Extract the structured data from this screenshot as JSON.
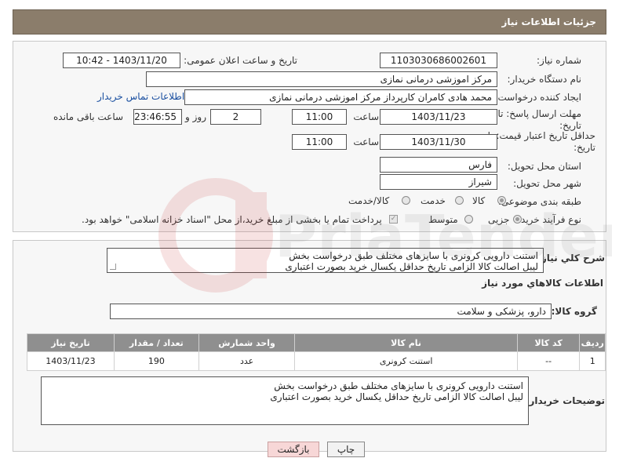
{
  "header": {
    "title": "جزئیات اطلاعات نیاز"
  },
  "form": {
    "need_number_label": "شماره نیاز:",
    "need_number": "1103030686002601",
    "announce_label": "تاریخ و ساعت اعلان عمومی:",
    "announce_value": "1403/11/20 - 10:42",
    "buyer_org_label": "نام دستگاه خریدار:",
    "buyer_org": "مرکز اموزشی درمانی نمازی",
    "requester_label": "ایجاد کننده درخواست:",
    "requester": "محمد هادی کامران کارپرداز مرکز اموزشی درمانی نمازی",
    "contact_link": "اطلاعات تماس خریدار",
    "reply_deadline_label": "مهلت ارسال پاسخ: تا تاریخ:",
    "reply_date": "1403/11/23",
    "time_label": "ساعت",
    "reply_time": "11:00",
    "days_value": "2",
    "days_label": "روز و",
    "remaining_time": "23:46:55",
    "remaining_label": "ساعت باقی مانده",
    "price_validity_label": "حداقل تاریخ اعتبار قیمت: تا تاریخ:",
    "price_date": "1403/11/30",
    "price_time": "11:00",
    "province_label": "استان محل تحویل:",
    "province": "فارس",
    "city_label": "شهر محل تحویل:",
    "city": "شیراز",
    "category_label": "طبقه بندی موضوعی:",
    "category_options": [
      "کالا",
      "خدمت",
      "کالا/خدمت"
    ],
    "process_label": "نوع فرآیند خرید :",
    "process_options": [
      "جزیی",
      "متوسط"
    ],
    "payment_note": "پرداخت تمام یا بخشی از مبلغ خرید،از محل \"اسناد خزانه اسلامی\" خواهد بود."
  },
  "summary": {
    "general_desc_label": "شرح كلي نياز:",
    "general_desc_line1": "استنت دارویی کرونری با سایزهای مختلف طبق درخواست بخش",
    "general_desc_line2": "لیبل اصالت کالا الزامی تاریخ حداقل یکسال خرید بصورت اعتباری",
    "goods_info_title": "اطلاعات کالاهاي مورد نياز",
    "goods_group_label": "گروه کالا:",
    "goods_group": "دارو، پزشکی و سلامت"
  },
  "table": {
    "headers": [
      "ردیف",
      "کد کالا",
      "نام کالا",
      "واحد شمارش",
      "تعداد / مقدار",
      "تاریخ نیاز"
    ],
    "rows": [
      [
        "1",
        "--",
        "استنت کرونری",
        "عدد",
        "190",
        "1403/11/23"
      ]
    ]
  },
  "buyer_notes": {
    "label": "توضیحات خریدار:",
    "line1": "استنت دارویی کرونری با سایزهای مختلف طبق درخواست بخش",
    "line2": "لیبل اصالت کالا الزامی تاریخ حداقل یکسال خرید بصورت اعتباری"
  },
  "buttons": {
    "print": "چاپ",
    "back": "بازگشت"
  },
  "watermark_text": "PriaTender.net",
  "colors": {
    "header_bg": "#8b7d6b",
    "table_header_bg": "#8f8f8f",
    "link": "#1a4fa0",
    "back_btn": "#f7d7d7"
  }
}
